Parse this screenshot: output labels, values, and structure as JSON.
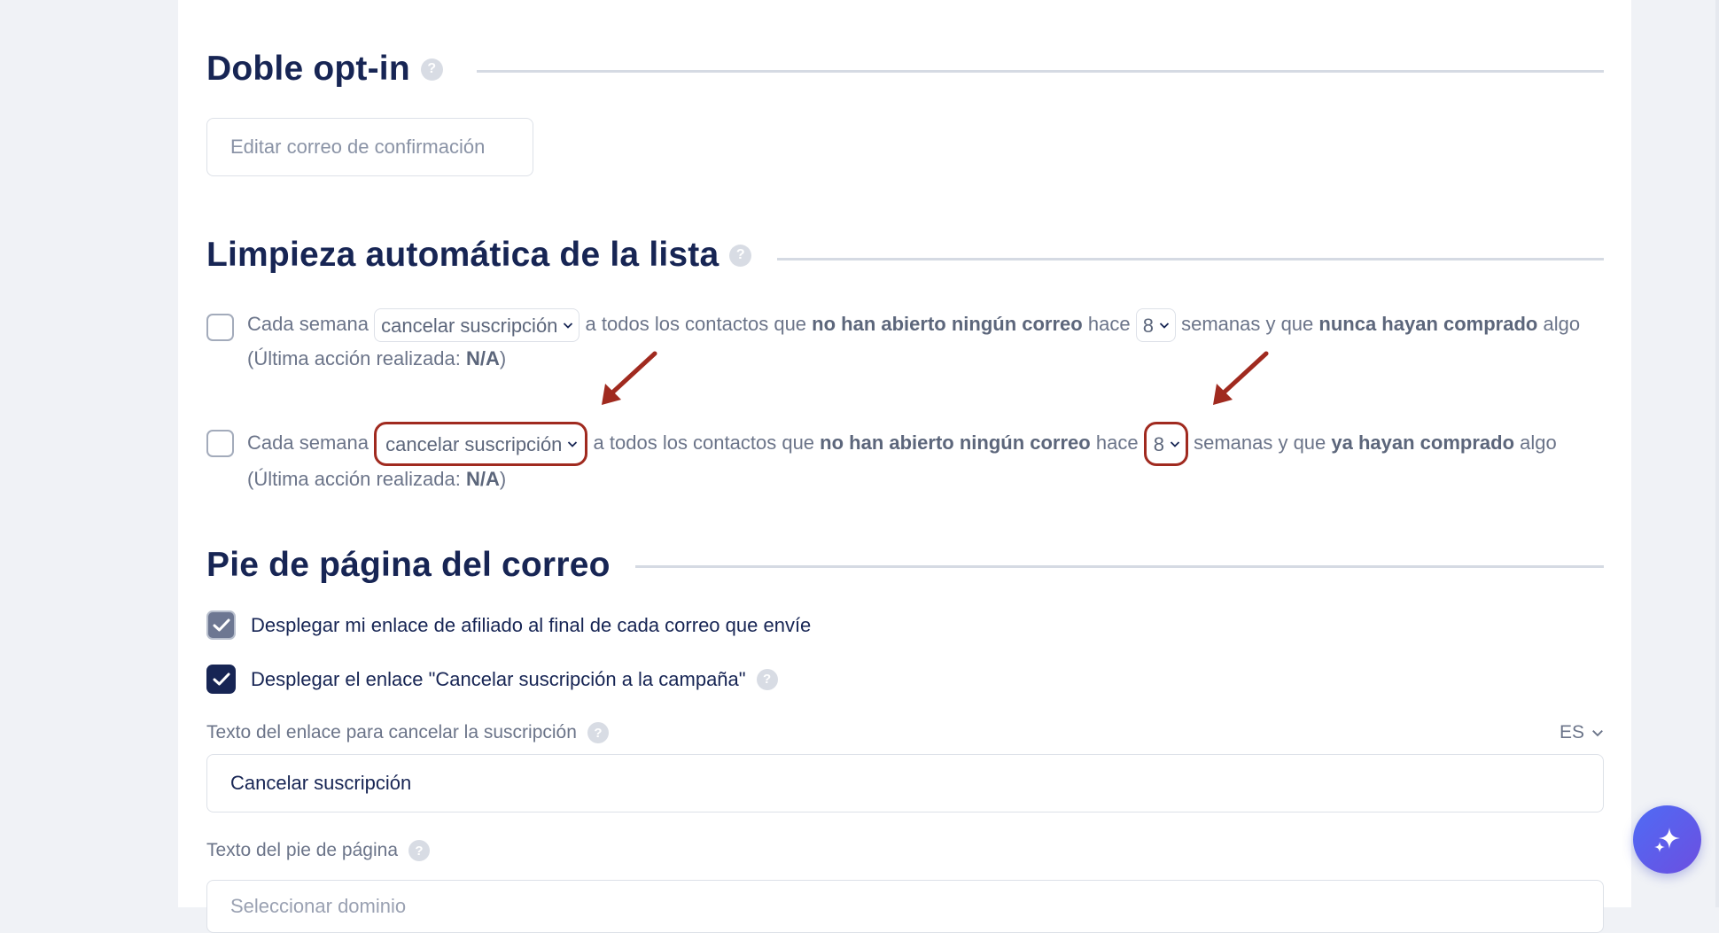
{
  "double_optin": {
    "title": "Doble opt-in",
    "help": "?",
    "edit_button": "Editar correo de confirmación"
  },
  "list_cleanup": {
    "title": "Limpieza automática de la lista",
    "help": "?",
    "rules": [
      {
        "prefix": "Cada semana",
        "action": "cancelar suscripción",
        "middle": "a todos los contactos que",
        "condition": "no han abierto ningún correo",
        "hace": "hace",
        "weeks": "8",
        "after_weeks": "semanas y que",
        "purchase": "nunca hayan comprado",
        "suffix": "algo",
        "last_action_label": "(Última acción realizada:",
        "last_action_value": "N/A",
        "last_action_close": ")"
      },
      {
        "prefix": "Cada semana",
        "action": "cancelar suscripción",
        "middle": "a todos los contactos que",
        "condition": "no han abierto ningún correo",
        "hace": "hace",
        "weeks": "8",
        "after_weeks": "semanas y que",
        "purchase": "ya hayan comprado",
        "suffix": "algo",
        "last_action_label": "(Última acción realizada:",
        "last_action_value": "N/A",
        "last_action_close": ")"
      }
    ]
  },
  "footer": {
    "title": "Pie de página del correo",
    "affiliate_label": "Desplegar mi enlace de afiliado al final de cada correo que envíe",
    "unsubscribe_label": "Desplegar el enlace \"Cancelar suscripción a la campaña\"",
    "help": "?",
    "unsubscribe_text_label": "Texto del enlace para cancelar la suscripción",
    "language": "ES",
    "unsubscribe_text_value": "Cancelar suscripción",
    "footer_text_label": "Texto del pie de página",
    "domain_placeholder": "Seleccionar dominio"
  },
  "colors": {
    "accent": "#172554",
    "annotation": "#a02a1f",
    "ai_button": "#5a5ef0"
  }
}
